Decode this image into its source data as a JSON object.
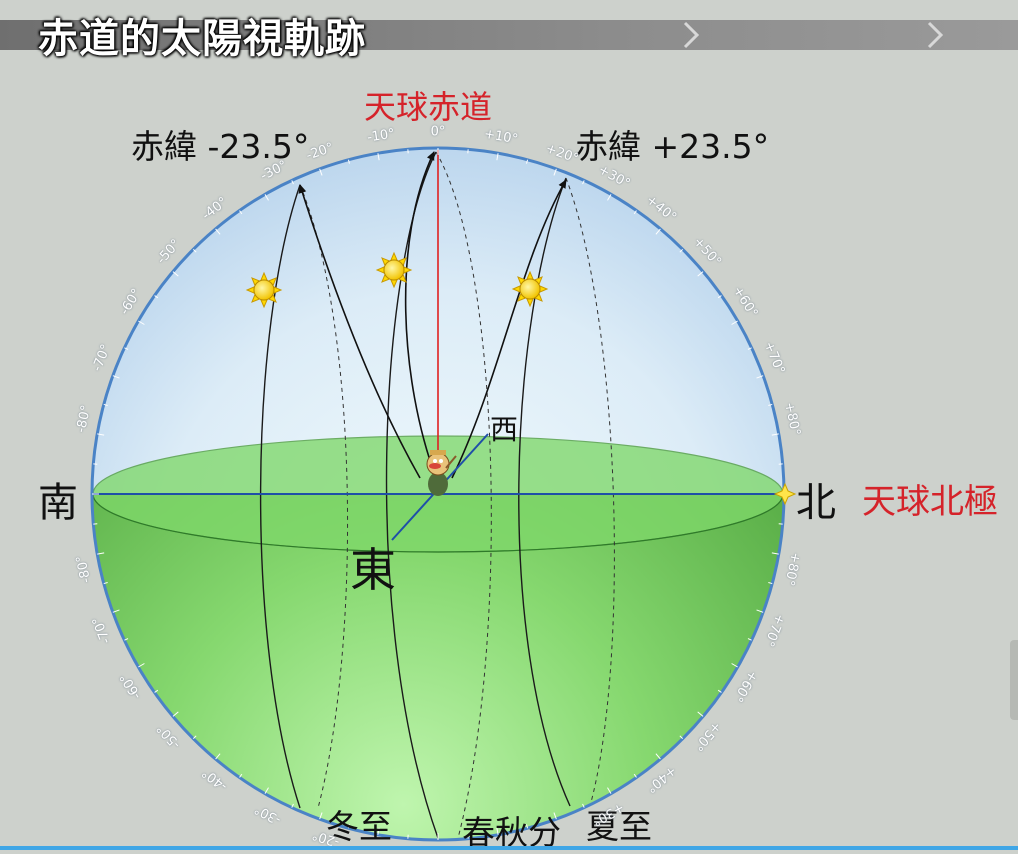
{
  "title": "赤道的太陽視軌跡",
  "labels": {
    "celestial_equator": "天球赤道",
    "dec_minus": "赤緯 -23.5°",
    "dec_plus": "赤緯 +23.5°",
    "south": "南",
    "north": "北",
    "east": "東",
    "west": "西",
    "north_pole": "天球北極",
    "winter_solstice": "冬至",
    "equinox": "春秋分",
    "summer_solstice": "夏至"
  },
  "scale_ticks": {
    "top": [
      "-30°",
      "-20°",
      "-10°",
      "0°",
      "+10°",
      "+20°",
      "+30°"
    ],
    "upper_left": [
      "-40°",
      "-50°",
      "-60°",
      "-70°",
      "-80°"
    ],
    "upper_right": [
      "+40°",
      "+50°",
      "+60°",
      "+70°",
      "+80°"
    ],
    "lower_left": [
      "-80°",
      "-70°",
      "-60°",
      "-50°",
      "-40°",
      "-30°",
      "-20°"
    ],
    "lower_right": [
      "+80°",
      "+70°",
      "+60°",
      "+50°",
      "+40°",
      "+30°"
    ]
  },
  "colors": {
    "sky_top": "#c6dcf2",
    "sky_bottom": "#eaf6fb",
    "ground": "#6fc85a",
    "horizon_plane": "#7ed96a",
    "ring": "#4a83c6",
    "axis_line": "#1f4fa8",
    "zenith_line": "#e02020",
    "red_label": "#d5232a",
    "sun": "#ffd800"
  }
}
